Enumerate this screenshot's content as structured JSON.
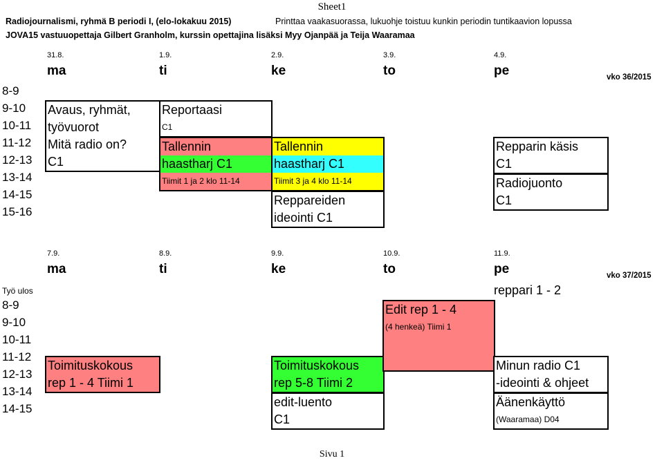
{
  "document": {
    "sheet_title": "Sheet1",
    "footer": "Sivu 1",
    "header_line_1": "Radiojournalismi, ryhmä B periodi I, (elo-lokakuu 2015)",
    "header_note": "Printtaa vaakasuorassa, lukuohje toistuu kunkin periodin tuntikaavion lopussa",
    "header_line_2": "JOVA15 vastuuopettaja Gilbert Granholm, kurssin opettajina lisäksi Myy Ojanpää ja Teija Waaramaa"
  },
  "week1": {
    "week_label": "vko 36/2015",
    "days": [
      {
        "date": "31.8.",
        "name": "ma"
      },
      {
        "date": "1.9.",
        "name": "ti"
      },
      {
        "date": "2.9.",
        "name": "ke"
      },
      {
        "date": "3.9.",
        "name": "to"
      },
      {
        "date": "4.9.",
        "name": "pe"
      }
    ],
    "time_rows": [
      "8-9",
      "9-10",
      "10-11",
      "11-12",
      "12-13",
      "13-14",
      "14-15",
      "15-16"
    ],
    "events": [
      {
        "day": "ma",
        "lines": [
          {
            "text": "Avaus, ryhmät,",
            "color": "#ffffff",
            "size": "big"
          },
          {
            "text": "työvuorot",
            "color": "#ffffff",
            "size": "big"
          },
          {
            "text": "Mitä radio on?",
            "color": "#ffffff",
            "size": "big"
          },
          {
            "text": "C1",
            "color": "#ffffff",
            "size": "big"
          }
        ]
      },
      {
        "day": "ti",
        "lines": [
          {
            "text": "Reportaasi",
            "color": "#ffffff",
            "size": "big"
          },
          {
            "text": "C1",
            "color": "#ffffff",
            "size": "small"
          }
        ]
      },
      {
        "day": "ti",
        "lines": [
          {
            "text": "Tallennin",
            "color": "#ff8080",
            "size": "big"
          },
          {
            "text": "haastharj C1",
            "color": "#33ff33",
            "size": "big"
          },
          {
            "text": "Tiimit 1 ja 2 klo 11-14",
            "color": "#ff8080",
            "size": "small"
          }
        ]
      },
      {
        "day": "ke",
        "lines": [
          {
            "text": "Tallennin",
            "color": "#ffff00",
            "size": "big"
          },
          {
            "text": "haastharj C1",
            "color": "#33ffff",
            "size": "big"
          },
          {
            "text": "Tiimit 3 ja 4 klo 11-14",
            "color": "#ffff00",
            "size": "small"
          }
        ]
      },
      {
        "day": "ke",
        "lines": [
          {
            "text": "Reppareiden",
            "color": "#ffffff",
            "size": "big"
          },
          {
            "text": "ideointi C1",
            "color": "#ffffff",
            "size": "big"
          }
        ]
      },
      {
        "day": "pe",
        "lines": [
          {
            "text": "Repparin käsis",
            "color": "#ffffff",
            "size": "big"
          },
          {
            "text": "C1",
            "color": "#ffffff",
            "size": "big"
          }
        ]
      },
      {
        "day": "pe",
        "lines": [
          {
            "text": "Radiojuonto",
            "color": "#ffffff",
            "size": "big"
          },
          {
            "text": "C1",
            "color": "#ffffff",
            "size": "big"
          }
        ]
      }
    ]
  },
  "week2": {
    "week_label": "vko 37/2015",
    "note_tyo_ulos": "Työ ulos",
    "note_reppari": "reppari 1 - 2",
    "days": [
      {
        "date": "7.9.",
        "name": "ma"
      },
      {
        "date": "8.9.",
        "name": "ti"
      },
      {
        "date": "9.9.",
        "name": "ke"
      },
      {
        "date": "10.9.",
        "name": "to"
      },
      {
        "date": "11.9.",
        "name": "pe"
      }
    ],
    "time_rows": [
      "8-9",
      "9-10",
      "10-11",
      "11-12",
      "12-13",
      "13-14",
      "14-15"
    ],
    "events": [
      {
        "day": "ma",
        "lines": [
          {
            "text": "Toimituskokous",
            "color": "#ff8080",
            "size": "big"
          },
          {
            "text": "rep 1 - 4 Tiimi 1",
            "color": "#ff8080",
            "size": "big"
          }
        ]
      },
      {
        "day": "ke",
        "lines": [
          {
            "text": "Toimituskokous",
            "color": "#33ff33",
            "size": "big"
          },
          {
            "text": "rep 5-8 Tiimi 2",
            "color": "#33ff33",
            "size": "big"
          }
        ]
      },
      {
        "day": "ke",
        "lines": [
          {
            "text": "edit-luento",
            "color": "#ffffff",
            "size": "big"
          },
          {
            "text": "C1",
            "color": "#ffffff",
            "size": "big"
          }
        ]
      },
      {
        "day": "to",
        "lines": [
          {
            "text": "Edit rep 1 - 4",
            "color": "#ff8080",
            "size": "big"
          },
          {
            "text": "(4 henkeä) Tiimi 1",
            "color": "#ff8080",
            "size": "small"
          },
          {
            "text": "",
            "color": "#ff8080",
            "size": "big"
          },
          {
            "text": "",
            "color": "#ff8080",
            "size": "big"
          }
        ]
      },
      {
        "day": "pe",
        "lines": [
          {
            "text": "Minun radio C1",
            "color": "#ffffff",
            "size": "big"
          },
          {
            "text": "-ideointi & ohjeet",
            "color": "#ffffff",
            "size": "big"
          }
        ]
      },
      {
        "day": "pe",
        "lines": [
          {
            "text": "Äänenkäyttö",
            "color": "#ffffff",
            "size": "big"
          },
          {
            "text": "(Waaramaa) D04",
            "color": "#ffffff",
            "size": "small"
          }
        ]
      }
    ]
  }
}
